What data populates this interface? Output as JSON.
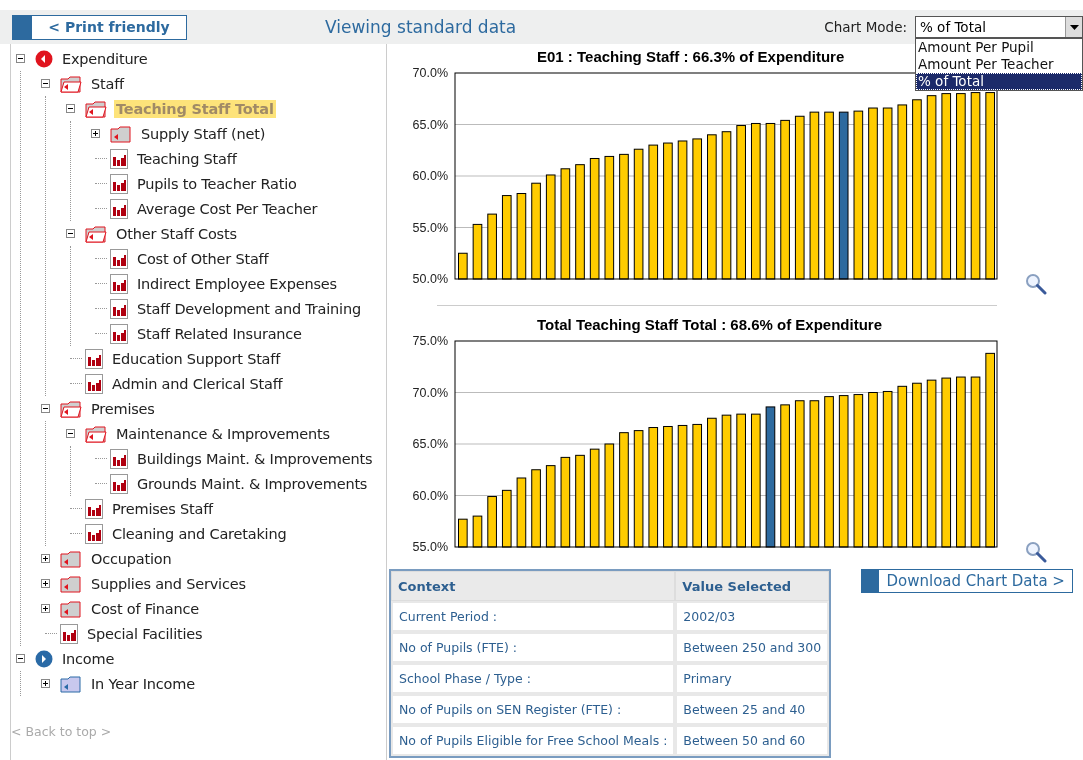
{
  "toolbar": {
    "print_button": "< Print friendly",
    "view_title": "Viewing standard data",
    "chart_mode": {
      "label": "Chart Mode:",
      "value": "% of Total",
      "expanded": true,
      "options": [
        {
          "label": "Amount Per Pupil",
          "selected": false
        },
        {
          "label": "Amount Per Teacher",
          "selected": false
        },
        {
          "label": "% of Total",
          "selected": true
        }
      ]
    }
  },
  "tree": [
    {
      "label": "Expenditure",
      "kind": "root-red",
      "expanded": true,
      "selected": false,
      "children": [
        {
          "label": "Staff",
          "kind": "folder-red",
          "expanded": true,
          "selected": false,
          "children": [
            {
              "label": "Teaching Staff Total",
              "kind": "folder-red",
              "expanded": true,
              "selected": true,
              "children": [
                {
                  "label": "Supply Staff (net)",
                  "kind": "folder-red",
                  "expanded": false,
                  "selected": false
                },
                {
                  "label": "Teaching Staff",
                  "kind": "chart",
                  "selected": false
                },
                {
                  "label": "Pupils to Teacher Ratio",
                  "kind": "chart",
                  "selected": false
                },
                {
                  "label": "Average Cost Per Teacher",
                  "kind": "chart",
                  "selected": false
                }
              ]
            },
            {
              "label": "Other Staff Costs",
              "kind": "folder-red",
              "expanded": true,
              "selected": false,
              "children": [
                {
                  "label": "Cost of Other Staff",
                  "kind": "chart",
                  "selected": false
                },
                {
                  "label": "Indirect Employee Expenses",
                  "kind": "chart",
                  "selected": false
                },
                {
                  "label": "Staff Development and Training",
                  "kind": "chart",
                  "selected": false
                },
                {
                  "label": "Staff Related Insurance",
                  "kind": "chart",
                  "selected": false
                }
              ]
            },
            {
              "label": "Education Support Staff",
              "kind": "chart",
              "selected": false
            },
            {
              "label": "Admin and Clerical Staff",
              "kind": "chart",
              "selected": false
            }
          ]
        },
        {
          "label": "Premises",
          "kind": "folder-red",
          "expanded": true,
          "selected": false,
          "children": [
            {
              "label": "Maintenance & Improvements",
              "kind": "folder-red",
              "expanded": true,
              "selected": false,
              "children": [
                {
                  "label": "Buildings Maint. & Improvements",
                  "kind": "chart",
                  "selected": false
                },
                {
                  "label": "Grounds Maint. & Improvements",
                  "kind": "chart",
                  "selected": false
                }
              ]
            },
            {
              "label": "Premises Staff",
              "kind": "chart",
              "selected": false
            },
            {
              "label": "Cleaning and Caretaking",
              "kind": "chart",
              "selected": false
            }
          ]
        },
        {
          "label": "Occupation",
          "kind": "folder-red",
          "expanded": false,
          "selected": false
        },
        {
          "label": "Supplies and Services",
          "kind": "folder-red",
          "expanded": false,
          "selected": false
        },
        {
          "label": "Cost of Finance",
          "kind": "folder-red",
          "expanded": false,
          "selected": false
        },
        {
          "label": "Special Facilities",
          "kind": "chart",
          "selected": false
        }
      ]
    },
    {
      "label": "Income",
      "kind": "root-blue",
      "expanded": true,
      "selected": false,
      "children": [
        {
          "label": "In Year Income",
          "kind": "folder-blue",
          "expanded": false,
          "selected": false
        }
      ]
    }
  ],
  "back_link": "< Back to top >",
  "charts": [
    {
      "chart_data": {
        "type": "bar",
        "title": "E01 : Teaching Staff : 66.3% of Expenditure",
        "ylim": [
          50,
          70
        ],
        "yticks": [
          {
            "value": 50,
            "label": "50.0%"
          },
          {
            "value": 55,
            "label": "55.0%"
          },
          {
            "value": 60,
            "label": "60.0%"
          },
          {
            "value": 65,
            "label": "65.0%"
          },
          {
            "value": 70,
            "label": "70.0%"
          }
        ],
        "grid": true,
        "stacked": true,
        "series": [
          {
            "color": "#ffcc00",
            "values": [
              52.5,
              55.3,
              56.3,
              58.1,
              58.3,
              59.3,
              60.1,
              60.7,
              61.1,
              61.7,
              61.9,
              62.1,
              62.6,
              63.0,
              63.2,
              63.4,
              63.6,
              64.0,
              64.3,
              64.9,
              65.1,
              65.1,
              65.4,
              65.8,
              66.2,
              66.2,
              null,
              66.3,
              66.6,
              66.6,
              66.9,
              67.4,
              67.8,
              68.0,
              68.0,
              68.1,
              68.1
            ]
          },
          {
            "color": "#2d6a9f",
            "values": [
              null,
              null,
              null,
              null,
              null,
              null,
              null,
              null,
              null,
              null,
              null,
              null,
              null,
              null,
              null,
              null,
              null,
              null,
              null,
              null,
              null,
              null,
              null,
              null,
              null,
              null,
              66.2,
              null,
              null,
              null,
              null,
              null,
              null,
              null,
              null,
              null,
              null
            ]
          }
        ]
      }
    },
    {
      "chart_data": {
        "type": "bar",
        "title": "Total Teaching Staff Total : 68.6% of Expenditure",
        "ylim": [
          55,
          75
        ],
        "yticks": [
          {
            "value": 55,
            "label": "55.0%"
          },
          {
            "value": 60,
            "label": "60.0%"
          },
          {
            "value": 65,
            "label": "65.0%"
          },
          {
            "value": 70,
            "label": "70.0%"
          },
          {
            "value": 75,
            "label": "75.0%"
          }
        ],
        "grid": true,
        "stacked": true,
        "series": [
          {
            "color": "#ffcc00",
            "values": [
              57.7,
              58.0,
              59.9,
              60.5,
              61.7,
              62.5,
              62.9,
              63.7,
              63.9,
              64.5,
              65.0,
              66.1,
              66.3,
              66.6,
              66.7,
              66.8,
              66.9,
              67.5,
              67.8,
              67.9,
              67.9,
              null,
              68.8,
              69.2,
              69.2,
              69.6,
              69.7,
              69.8,
              70.0,
              70.1,
              70.6,
              70.9,
              71.2,
              71.4,
              71.5,
              71.5,
              73.8
            ]
          },
          {
            "color": "#2d6a9f",
            "values": [
              null,
              null,
              null,
              null,
              null,
              null,
              null,
              null,
              null,
              null,
              null,
              null,
              null,
              null,
              null,
              null,
              null,
              null,
              null,
              null,
              null,
              68.6,
              null,
              null,
              null,
              null,
              null,
              null,
              null,
              null,
              null,
              null,
              null,
              null,
              null,
              null,
              null
            ]
          }
        ]
      }
    }
  ],
  "context_table": {
    "columns": [
      "Context",
      "Value Selected"
    ],
    "rows": [
      [
        "Current Period :",
        "2002/03"
      ],
      [
        "No of Pupils (FTE) :",
        "Between 250 and 300"
      ],
      [
        "School Phase / Type :",
        "Primary"
      ],
      [
        "No of Pupils on SEN Register (FTE) :",
        "Between 25 and 40"
      ],
      [
        "No of Pupils Eligible for Free School Meals :",
        "Between 50 and 60"
      ]
    ]
  },
  "download_button": "Download Chart Data >"
}
